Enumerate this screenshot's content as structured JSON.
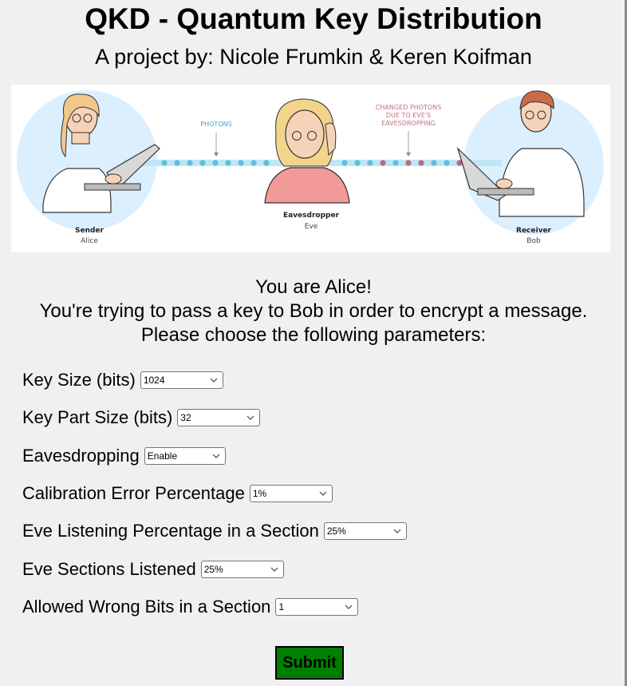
{
  "header": {
    "title": "QKD - Quantum Key Distribution",
    "subtitle": "A project by: Nicole Frumkin & Keren Koifman"
  },
  "illustration": {
    "photons_label": "PHOTONS",
    "changed_label_line1": "CHANGED PHOTONS",
    "changed_label_line2": "DUE TO EVE'S",
    "changed_label_line3": "EAVESDROPPING",
    "sender_role": "Sender",
    "sender_name": "Alice",
    "eve_role": "Eavesdropper",
    "eve_name": "Eve",
    "receiver_role": "Receiver",
    "receiver_name": "Bob",
    "colors": {
      "photon": "#5bc0de",
      "changed_photon": "#b86b7a",
      "circle_bg": "#dcefff"
    }
  },
  "intro": {
    "line1": "You are Alice!",
    "line2": "You're trying to pass a key to Bob in order to encrypt a message.",
    "line3": "Please choose the following parameters:"
  },
  "form": {
    "key_size": {
      "label": "Key Size (bits)",
      "value": "1024"
    },
    "key_part_size": {
      "label": "Key Part Size (bits)",
      "value": "32"
    },
    "eavesdropping": {
      "label": "Eavesdropping",
      "value": "Enable"
    },
    "calibration_error": {
      "label": "Calibration Error Percentage",
      "value": "1%"
    },
    "eve_listening": {
      "label": "Eve Listening Percentage in a Section",
      "value": "25%"
    },
    "eve_sections": {
      "label": "Eve Sections Listened",
      "value": "25%"
    },
    "allowed_wrong_bits": {
      "label": "Allowed Wrong Bits in a Section",
      "value": "1"
    },
    "submit_label": "Submit"
  },
  "colors": {
    "background": "#f0f0f0",
    "submit_bg": "#008000"
  }
}
